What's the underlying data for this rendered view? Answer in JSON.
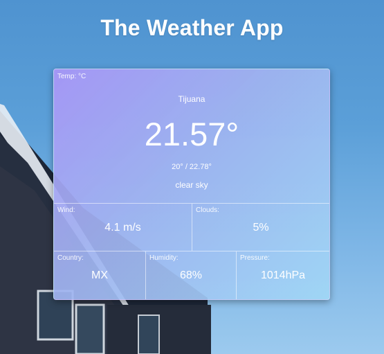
{
  "app": {
    "title": "The Weather App"
  },
  "weather": {
    "units_label": "Temp: °C",
    "city": "Tijuana",
    "temperature": "21.57°",
    "range": "20° / 22.78°",
    "description": "clear sky"
  },
  "details": {
    "wind": {
      "label": "Wind:",
      "value": "4.1 m/s"
    },
    "clouds": {
      "label": "Clouds:",
      "value": "5%"
    },
    "country": {
      "label": "Country:",
      "value": "MX"
    },
    "humidity": {
      "label": "Humidity:",
      "value": "68%"
    },
    "pressure": {
      "label": "Pressure:",
      "value": "1014hPa"
    }
  },
  "colors": {
    "sky_top": "#4f93d0",
    "sky_bottom": "#9ccaee",
    "card_start": "#a896f6",
    "card_end": "#a0d7f5",
    "text": "#ffffff"
  }
}
